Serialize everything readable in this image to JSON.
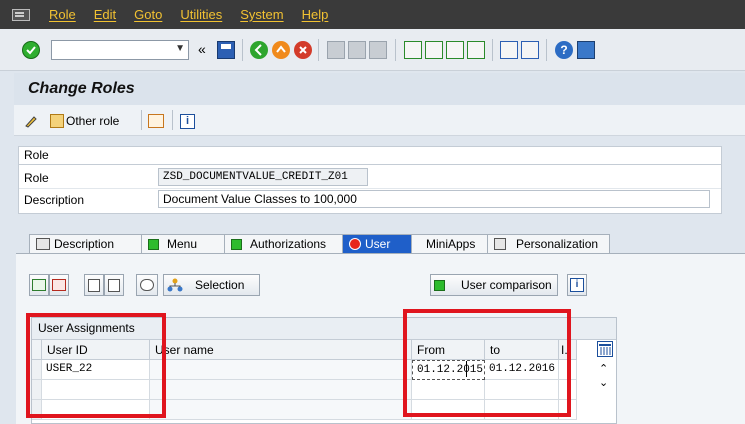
{
  "menu": [
    "Role",
    "Edit",
    "Goto",
    "Utilities",
    "System",
    "Help"
  ],
  "toolbar": {
    "command_field_value": "",
    "nav_back": "«"
  },
  "title": "Change Roles",
  "app_toolbar": {
    "other_role_label": "Other role"
  },
  "role_group": {
    "title": "Role",
    "role_label": "Role",
    "role_value": "ZSD_DOCUMENTVALUE_CREDIT_Z01",
    "description_label": "Description",
    "description_value": "Document Value Classes to 100,000"
  },
  "tabs": [
    "Description",
    "Menu",
    "Authorizations",
    "User",
    "MiniApps",
    "Personalization"
  ],
  "user_tab": {
    "selection_label": "Selection",
    "user_comparison_label": "User comparison",
    "table_title": "User Assignments",
    "columns": [
      "User ID",
      "User name",
      "From",
      "to",
      "I.."
    ],
    "rows": [
      {
        "user_id": "USER_22",
        "user_name": "",
        "from": "01.12.2015",
        "to": "01.12.2016"
      }
    ]
  },
  "colors": {
    "menubar_bg": "#3a3a3a",
    "menu_text": "#f2c232",
    "active_tab": "#1f5fc9",
    "highlight": "#e0151e"
  }
}
